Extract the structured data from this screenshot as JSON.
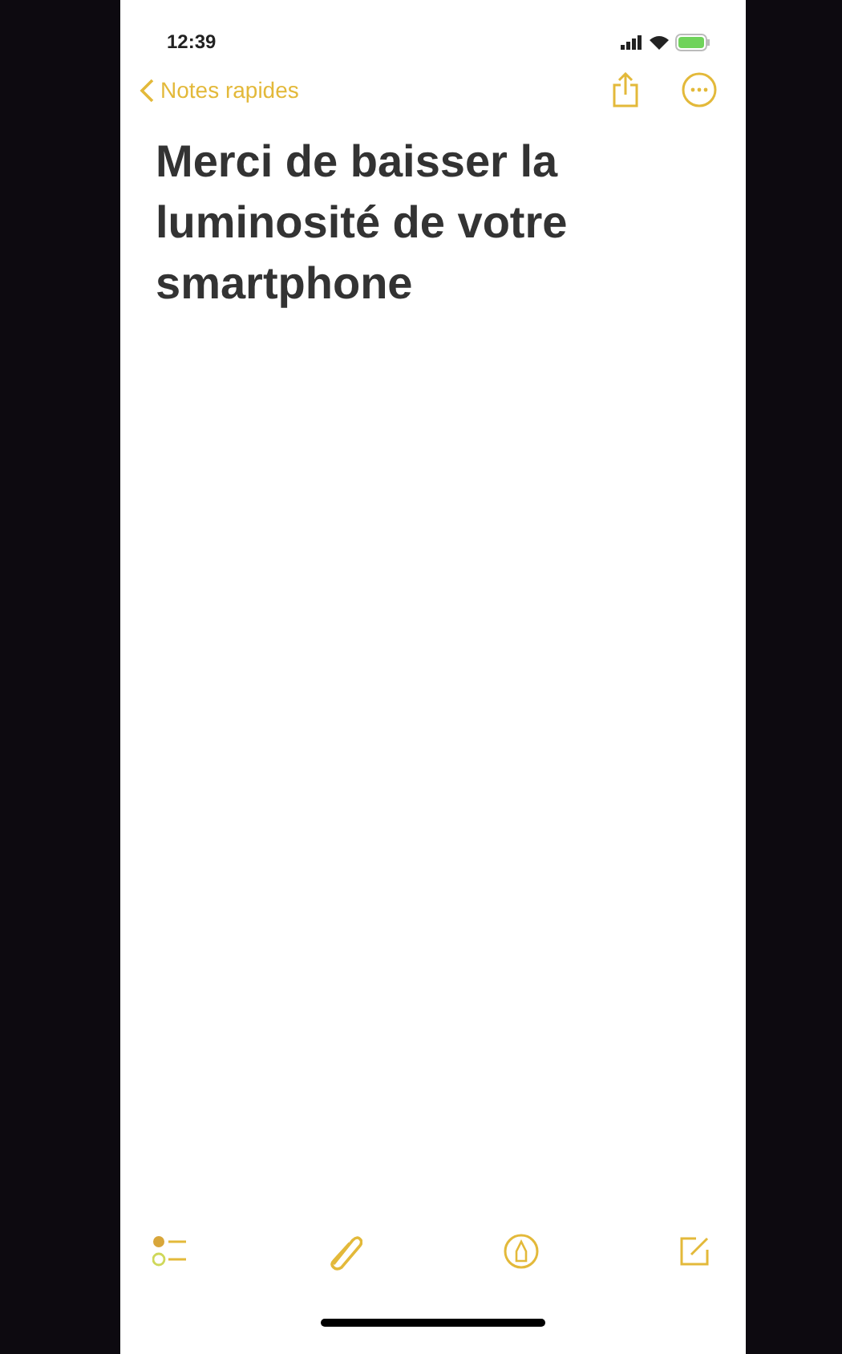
{
  "status_bar": {
    "time": "12:39"
  },
  "nav": {
    "back_label": "Notes rapides"
  },
  "note": {
    "title": "Merci de baisser la luminosité de votre smartphone"
  }
}
